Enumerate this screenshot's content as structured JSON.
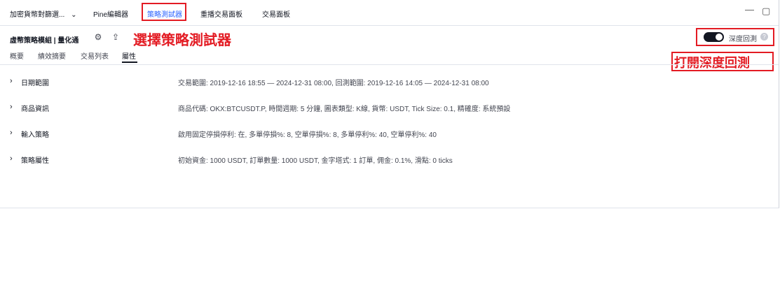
{
  "top_tabs": [
    {
      "label": "加密貨幣對篩選..."
    },
    {
      "label": "Pine編輯器"
    },
    {
      "label": "策略測試器"
    },
    {
      "label": "重播交易面板"
    },
    {
      "label": "交易面板"
    }
  ],
  "window_controls": {
    "minimize": "—",
    "maximize": "▢"
  },
  "header": {
    "title": "虛幣策略模組 | 量化通"
  },
  "annotations": {
    "select_tester": "選擇策略測試器",
    "deep_backtest": "打開深度回測"
  },
  "deep_backtest": {
    "label": "深度回測",
    "enabled": true,
    "help": "?"
  },
  "sub_tabs": [
    {
      "label": "概要"
    },
    {
      "label": "績效摘要"
    },
    {
      "label": "交易列表"
    },
    {
      "label": "屬性"
    }
  ],
  "rows": [
    {
      "label": "日期範圍",
      "value": "交易範圍: 2019-12-16 18:55 — 2024-12-31 08:00, 回測範圍: 2019-12-16 14:05 — 2024-12-31 08:00"
    },
    {
      "label": "商品資訊",
      "value": "商品代碼: OKX:BTCUSDT.P, 時間週期: 5 分鐘, 圖表類型: K線, 貨幣: USDT, Tick Size: 0.1, 精確度: 系統預設"
    },
    {
      "label": "輸入策略",
      "value": "啟用固定停損停利: 在, 多單停損%: 8, 空單停損%: 8, 多單停利%: 40, 空單停利%: 40"
    },
    {
      "label": "策略屬性",
      "value": "初始資金: 1000 USDT, 訂單數量: 1000 USDT, 金字塔式: 1 訂單, 佣金: 0.1%, 滑點: 0 ticks"
    }
  ],
  "colors": {
    "accent": "#2962ff",
    "annotation": "#e31b23"
  }
}
